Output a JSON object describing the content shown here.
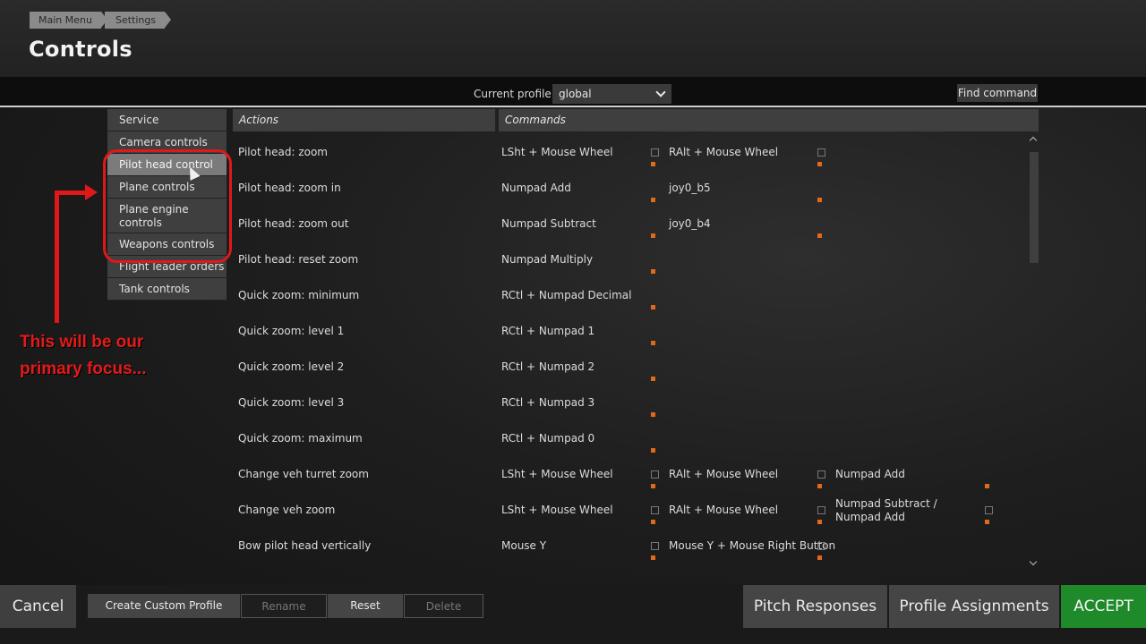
{
  "breadcrumb": [
    "Main Menu",
    "Settings"
  ],
  "page_title": "Controls",
  "profile": {
    "label": "Current profile",
    "value": "global"
  },
  "find_command": "Find command",
  "categories": [
    {
      "label": "Service"
    },
    {
      "label": "Camera controls"
    },
    {
      "label": "Pilot head control",
      "active": true
    },
    {
      "label": "Plane controls"
    },
    {
      "label": "Plane engine controls"
    },
    {
      "label": "Weapons controls"
    },
    {
      "label": "Flight leader orders"
    },
    {
      "label": "Tank controls"
    }
  ],
  "annotation": "This will be our primary focus...",
  "headers": {
    "actions": "Actions",
    "commands": "Commands"
  },
  "rows": [
    {
      "action": "Pilot head: zoom",
      "commands": [
        "LSht + Mouse Wheel",
        "RAlt + Mouse Wheel",
        ""
      ]
    },
    {
      "action": "Pilot head: zoom in",
      "commands": [
        "Numpad Add",
        "joy0_b5",
        ""
      ]
    },
    {
      "action": "Pilot head: zoom out",
      "commands": [
        "Numpad Subtract",
        "joy0_b4",
        ""
      ]
    },
    {
      "action": "Pilot head: reset zoom",
      "commands": [
        "Numpad Multiply",
        "",
        ""
      ]
    },
    {
      "action": "Quick zoom: minimum",
      "commands": [
        "RCtl + Numpad Decimal",
        "",
        ""
      ]
    },
    {
      "action": "Quick zoom: level 1",
      "commands": [
        "RCtl + Numpad 1",
        "",
        ""
      ]
    },
    {
      "action": "Quick zoom: level 2",
      "commands": [
        "RCtl + Numpad 2",
        "",
        ""
      ]
    },
    {
      "action": "Quick zoom: level 3",
      "commands": [
        "RCtl + Numpad 3",
        "",
        ""
      ]
    },
    {
      "action": "Quick zoom: maximum",
      "commands": [
        "RCtl + Numpad 0",
        "",
        ""
      ]
    },
    {
      "action": "Change veh turret zoom",
      "commands": [
        "LSht + Mouse Wheel",
        "RAlt + Mouse Wheel",
        "Numpad Add"
      ]
    },
    {
      "action": "Change veh zoom",
      "commands": [
        "LSht + Mouse Wheel",
        "RAlt + Mouse Wheel",
        "Numpad Subtract / Numpad Add"
      ]
    },
    {
      "action": "Bow pilot head vertically",
      "commands": [
        "Mouse Y",
        "Mouse Y + Mouse Right Button",
        ""
      ]
    }
  ],
  "buttons": {
    "cancel": "Cancel",
    "create_profile": "Create Custom Profile",
    "rename": "Rename",
    "reset": "Reset",
    "delete": "Delete",
    "pitch": "Pitch Responses",
    "assignments": "Profile Assignments",
    "accept": "ACCEPT"
  },
  "colors": {
    "accept": "#1e8a2a",
    "annotation": "#e01818",
    "key_marker": "#e06a1a"
  }
}
